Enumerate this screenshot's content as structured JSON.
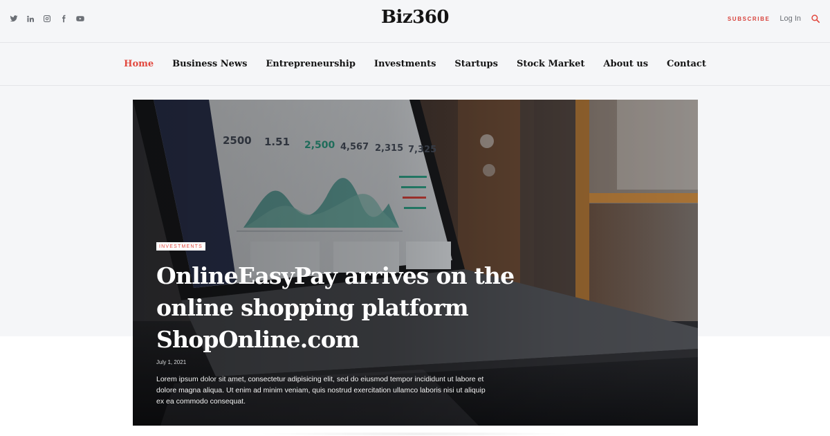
{
  "site": {
    "logo": "Biz360"
  },
  "header": {
    "socials": [
      {
        "icon": "twitter-icon"
      },
      {
        "icon": "linkedin-icon"
      },
      {
        "icon": "instagram-icon"
      },
      {
        "icon": "facebook-icon"
      },
      {
        "icon": "youtube-icon"
      }
    ],
    "subscribe_label": "SUBSCRIBE",
    "login_label": "Log In",
    "search_icon": "search-icon"
  },
  "nav": {
    "items": [
      {
        "label": "Home",
        "active": true
      },
      {
        "label": "Business News",
        "active": false
      },
      {
        "label": "Entrepreneurship",
        "active": false
      },
      {
        "label": "Investments",
        "active": false
      },
      {
        "label": "Startups",
        "active": false
      },
      {
        "label": "Stock Market",
        "active": false
      },
      {
        "label": "About us",
        "active": false
      },
      {
        "label": "Contact",
        "active": false
      }
    ]
  },
  "hero": {
    "category": "INVESTMENTS",
    "title": "OnlineEasyPay arrives on the online shopping platform ShopOnline.com",
    "date": "July 1, 2021",
    "excerpt": "Lorem ipsum dolor sit amet, consectetur adipisicing elit, sed do eiusmod tempor incididunt ut labore et dolore magna aliqua. Ut enim ad minim veniam, quis nostrud exercitation ullamco laboris nisi ut aliquip ex ea commodo consequat."
  },
  "theme": {
    "accent": "#e2493f",
    "text": "#141414",
    "muted": "#6b6f75",
    "band": "#f5f6f8"
  }
}
